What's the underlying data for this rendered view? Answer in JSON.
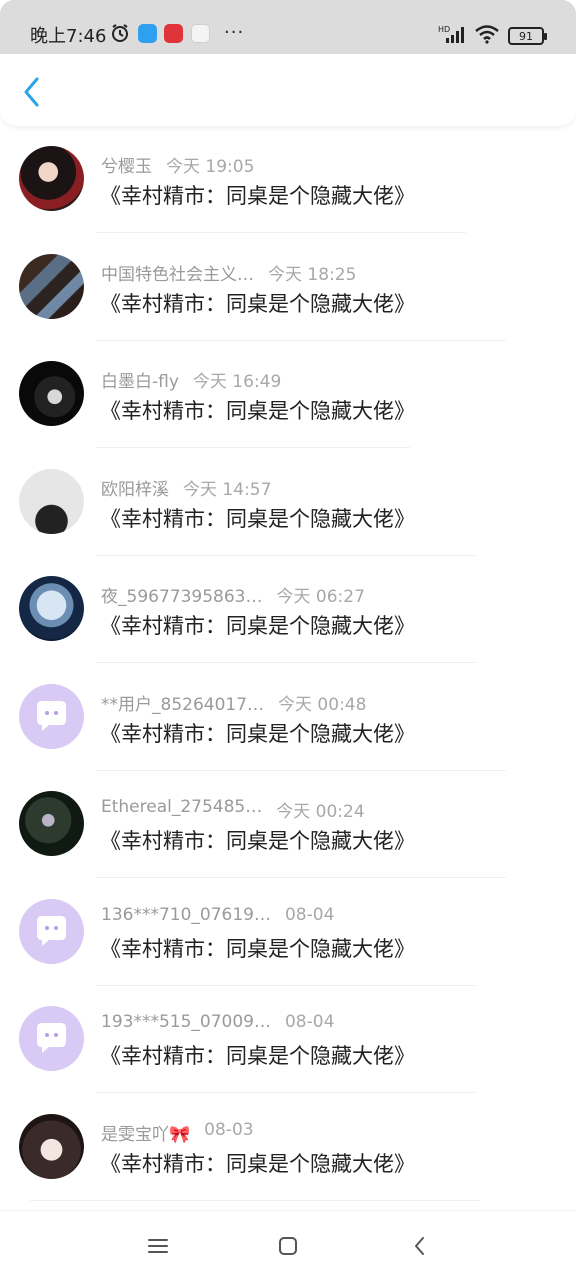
{
  "status_bar": {
    "time": "晚上7:46",
    "icons": [
      "alarm-icon",
      "app-icon",
      "app-icon",
      "baidu-icon",
      "more-icon",
      "hd-signal-icon",
      "wifi-icon",
      "battery-icon"
    ],
    "more": "···",
    "battery_level": "91"
  },
  "header": {
    "back_icon": "chevron-left-icon",
    "accent": "#2aa6e8"
  },
  "messages": [
    {
      "username": "兮樱玉",
      "time": "今天 19:05",
      "title": "《幸村精市：同桌是个隐藏大佬》",
      "avatar": "photo"
    },
    {
      "username": "中国特色社会主义…",
      "time": "今天 18:25",
      "title": "《幸村精市：同桌是个隐藏大佬》",
      "avatar": "photo"
    },
    {
      "username": "白墨白-fly",
      "time": "今天 16:49",
      "title": "《幸村精市：同桌是个隐藏大佬》",
      "avatar": "photo"
    },
    {
      "username": "欧阳梓溪",
      "time": "今天 14:57",
      "title": "《幸村精市：同桌是个隐藏大佬》",
      "avatar": "photo"
    },
    {
      "username": "夜_59677395863…",
      "time": "今天 06:27",
      "title": "《幸村精市：同桌是个隐藏大佬》",
      "avatar": "photo"
    },
    {
      "username": "**用户_85264017…",
      "time": "今天 00:48",
      "title": "《幸村精市：同桌是个隐藏大佬》",
      "avatar": "default"
    },
    {
      "username": "Ethereal_275485…",
      "time": "今天 00:24",
      "title": "《幸村精市：同桌是个隐藏大佬》",
      "avatar": "photo"
    },
    {
      "username": "136***710_07619…",
      "time": "08-04",
      "title": "《幸村精市：同桌是个隐藏大佬》",
      "avatar": "default"
    },
    {
      "username": "193***515_07009…",
      "time": "08-04",
      "title": "《幸村精市：同桌是个隐藏大佬》",
      "avatar": "default"
    },
    {
      "username": "是雯宝吖🎀",
      "time": "08-03",
      "title": "《幸村精市：同桌是个隐藏大佬》",
      "avatar": "photo"
    }
  ],
  "nav_bar": {
    "buttons": [
      "menu-icon",
      "home-icon",
      "back-icon"
    ]
  },
  "colors": {
    "default_avatar": "#d9c9f5",
    "meta_text": "#9a9a9a",
    "title_text": "#222222"
  }
}
